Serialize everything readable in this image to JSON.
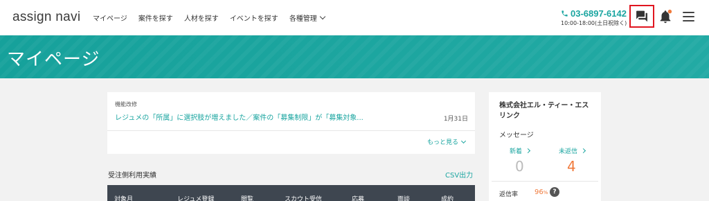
{
  "header": {
    "logo": "assign navi",
    "nav": [
      "マイページ",
      "案件を探す",
      "人材を探す",
      "イベントを探す",
      "各種管理"
    ],
    "phone_number": "03-6897-6142",
    "phone_hours": "10:00-18:00(土日祝除く)"
  },
  "banner": {
    "title": "マイページ"
  },
  "news": {
    "category": "機能改修",
    "headline": "レジュメの「所属」に選択肢が増えました／案件の「募集制限」が「募集対象...",
    "date": "1月31日",
    "more": "もっと見る"
  },
  "performance": {
    "title": "受注側利用実績",
    "csv_label": "CSV出力",
    "columns": [
      "対象月",
      "レジュメ登録",
      "閲覧",
      "スカウト受信",
      "応募",
      "面談",
      "成約"
    ]
  },
  "sidebar": {
    "company": "株式会社エル・ティー・エスリンク",
    "message_label": "メッセージ",
    "new_label": "新着",
    "new_count": "0",
    "unreplied_label": "未返信",
    "unreplied_count": "4",
    "reply_rate_label": "返信率",
    "reply_rate_value": "96",
    "reply_rate_unit": "%",
    "help": "?"
  },
  "colors": {
    "accent": "#1aa5a0",
    "alert": "#f07a3c",
    "highlight_border": "#e0151f",
    "table_header": "#3e4650"
  },
  "icons": [
    "phone-icon",
    "chat-icon",
    "bell-icon",
    "menu-icon"
  ]
}
